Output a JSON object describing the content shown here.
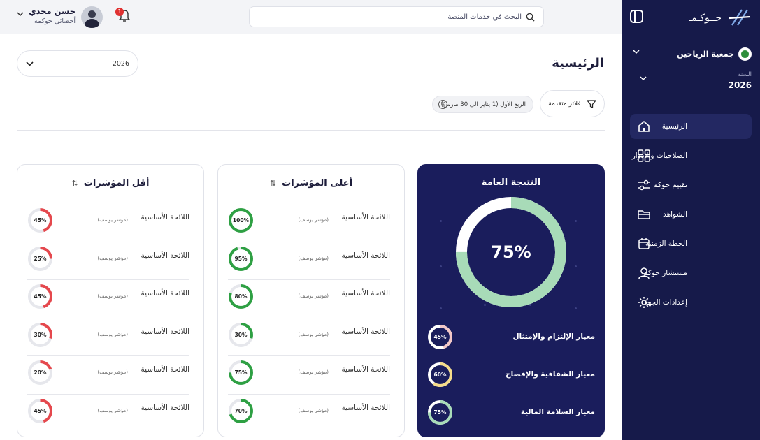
{
  "sidebar": {
    "logo_text": "حــوكـمـ",
    "org_name": "جمعية الرياحين",
    "year_caption": "السنة",
    "year_value": "2026",
    "items": [
      {
        "label": "الرئيسية",
        "icon": "home-icon",
        "active": true
      },
      {
        "label": "الصلاحيات والادوار",
        "icon": "grid-icon",
        "active": false
      },
      {
        "label": "تقييم حوكم",
        "icon": "sliders-icon",
        "active": false
      },
      {
        "label": "الشواهد",
        "icon": "folder-icon",
        "active": false
      },
      {
        "label": "الخطة الزمنية",
        "icon": "calendar-icon",
        "active": false
      },
      {
        "label": "مستشار حوكم",
        "icon": "user-icon",
        "active": false
      },
      {
        "label": "إعدادات الجهة",
        "icon": "gear-icon",
        "active": false
      }
    ]
  },
  "topbar": {
    "search_placeholder": "البحث في خدمات المنصة",
    "user_name": "حسن مجدي",
    "user_role": "أخصائي حوكمة",
    "notifications": "1"
  },
  "main": {
    "page_title": "الرئيسية",
    "year_select_value": "2026",
    "filter_button_label": "فلاتر متقدمة",
    "filter_chip_label": "الربع الأول (1 يناير الى 30 مارس)"
  },
  "overall": {
    "title": "النتيجة العامة",
    "percent": 75,
    "percent_label": "75%",
    "standards": [
      {
        "label": "معيار الإلتزام والإمتثال",
        "percent": 45,
        "value_label": "45%",
        "color": "#f2c7c7"
      },
      {
        "label": "معيار الشفافية والإفصاح",
        "percent": 60,
        "value_label": "60%",
        "color": "#f5dc8a"
      },
      {
        "label": "معيار السلامة المالية",
        "percent": 75,
        "value_label": "75%",
        "color": "#a8dbb8"
      }
    ]
  },
  "high_indicators": {
    "title": "أعلى المؤشرات",
    "sort_icon": "sort-icon",
    "color": "#2ea043",
    "items": [
      {
        "label": "اللائحة الأساسية",
        "sub": "(مؤشر يوسف)",
        "percent": 100,
        "value_label": "100%"
      },
      {
        "label": "اللائحة الأساسية",
        "sub": "(مؤشر يوسف)",
        "percent": 95,
        "value_label": "95%"
      },
      {
        "label": "اللائحة الأساسية",
        "sub": "(مؤشر يوسف)",
        "percent": 80,
        "value_label": "80%"
      },
      {
        "label": "اللائحة الأساسية",
        "sub": "(مؤشر يوسف)",
        "percent": 30,
        "value_label": "30%"
      },
      {
        "label": "اللائحة الأساسية",
        "sub": "(مؤشر يوسف)",
        "percent": 75,
        "value_label": "75%"
      },
      {
        "label": "اللائحة الأساسية",
        "sub": "(مؤشر يوسف)",
        "percent": 70,
        "value_label": "70%"
      }
    ]
  },
  "low_indicators": {
    "title": "أقل المؤشرات",
    "sort_icon": "sort-icon",
    "color": "#e5484d",
    "items": [
      {
        "label": "اللائحة الأساسية",
        "sub": "(مؤشر يوسف)",
        "percent": 45,
        "value_label": "45%"
      },
      {
        "label": "اللائحة الأساسية",
        "sub": "(مؤشر يوسف)",
        "percent": 25,
        "value_label": "25%"
      },
      {
        "label": "اللائحة الأساسية",
        "sub": "(مؤشر يوسف)",
        "percent": 45,
        "value_label": "45%"
      },
      {
        "label": "اللائحة الأساسية",
        "sub": "(مؤشر يوسف)",
        "percent": 30,
        "value_label": "30%"
      },
      {
        "label": "اللائحة الأساسية",
        "sub": "(مؤشر يوسف)",
        "percent": 20,
        "value_label": "20%"
      },
      {
        "label": "اللائحة الأساسية",
        "sub": "(مؤشر يوسف)",
        "percent": 45,
        "value_label": "45%"
      }
    ]
  }
}
